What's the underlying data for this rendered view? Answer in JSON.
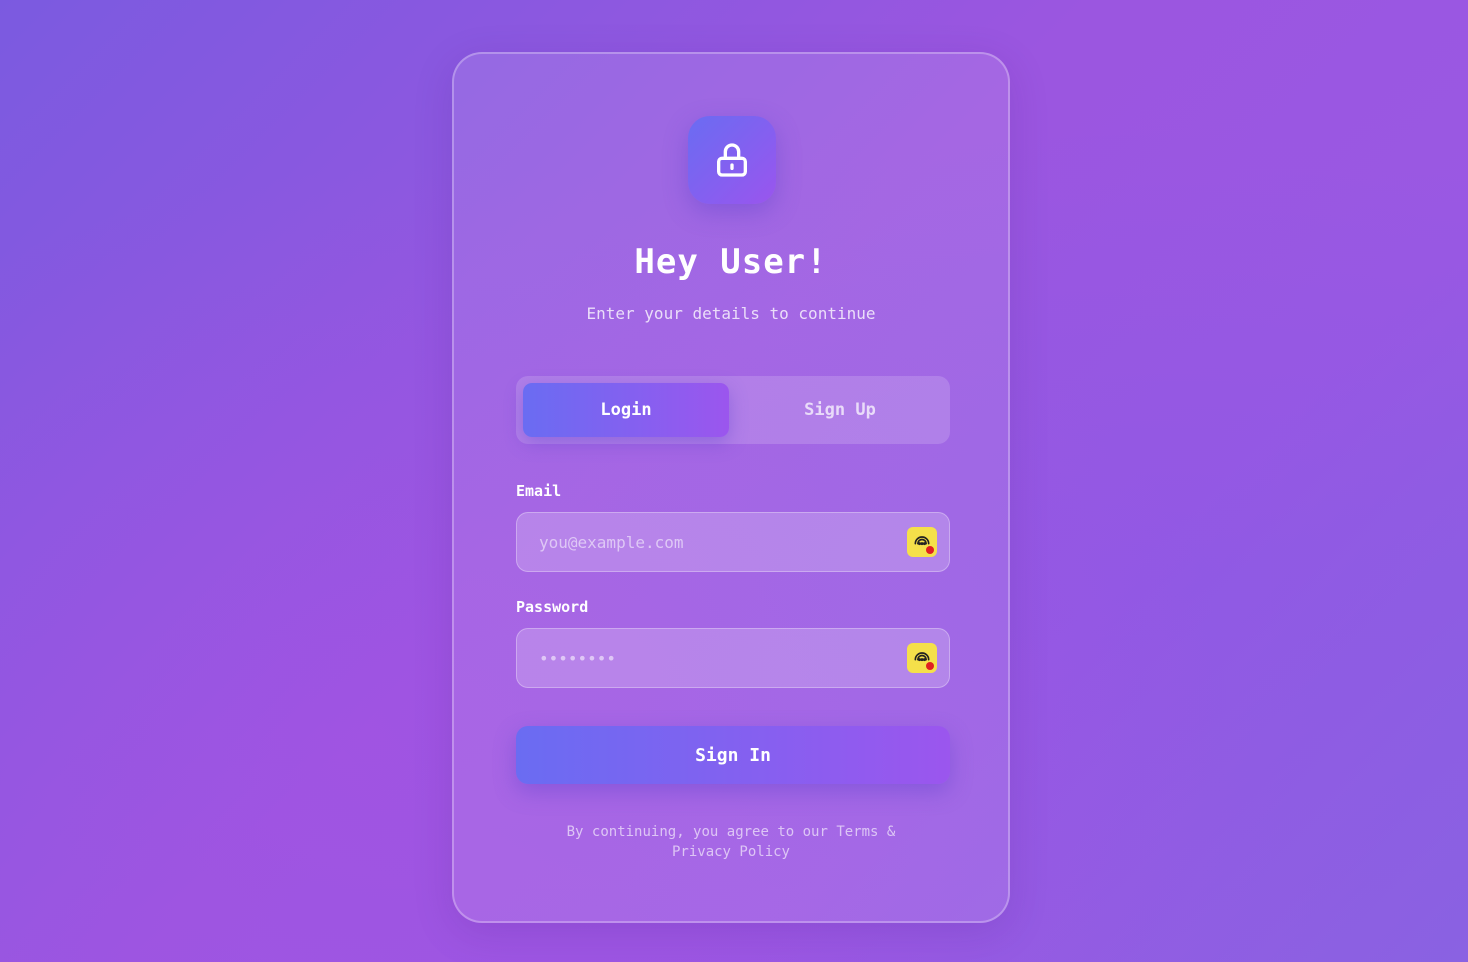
{
  "header": {
    "title": "Hey User!",
    "subtitle": "Enter your details to continue"
  },
  "tabs": [
    {
      "label": "Login",
      "active": true
    },
    {
      "label": "Sign Up",
      "active": false
    }
  ],
  "form": {
    "email": {
      "label": "Email",
      "placeholder": "you@example.com",
      "value": ""
    },
    "password": {
      "label": "Password",
      "placeholder": "••••••••",
      "value": ""
    },
    "submit_label": "Sign In"
  },
  "footer": {
    "text": "By continuing, you agree to our Terms & Privacy Policy"
  },
  "icons": {
    "logo": "lock-icon",
    "field_extension": "password-manager-extension-icon"
  },
  "colors": {
    "accent_start": "#6a6cf2",
    "accent_end": "#9b56ee",
    "extension_badge": "#f5e04a"
  }
}
